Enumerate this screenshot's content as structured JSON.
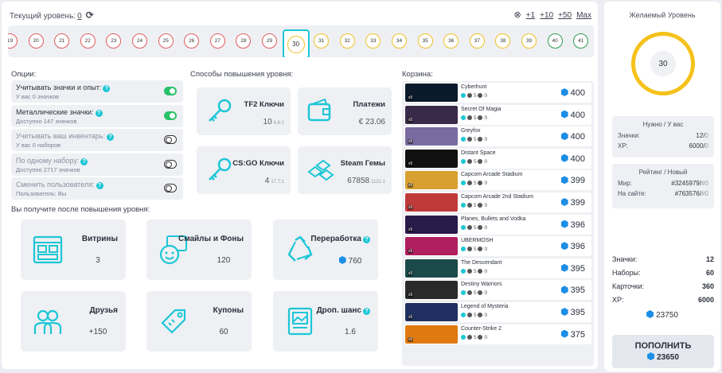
{
  "header": {
    "current_level_label": "Текущий уровень:",
    "current_level_value": "0",
    "plus1": "+1",
    "plus10": "+10",
    "plus50": "+50",
    "max": "Max"
  },
  "levels": [
    {
      "n": "19",
      "c": "r"
    },
    {
      "n": "20",
      "c": "r"
    },
    {
      "n": "21",
      "c": "r"
    },
    {
      "n": "22",
      "c": "r"
    },
    {
      "n": "23",
      "c": "r"
    },
    {
      "n": "24",
      "c": "r"
    },
    {
      "n": "25",
      "c": "r"
    },
    {
      "n": "26",
      "c": "r"
    },
    {
      "n": "27",
      "c": "r"
    },
    {
      "n": "28",
      "c": "r"
    },
    {
      "n": "29",
      "c": "r"
    },
    {
      "n": "30",
      "c": "cur"
    },
    {
      "n": "31",
      "c": "y"
    },
    {
      "n": "32",
      "c": "y"
    },
    {
      "n": "33",
      "c": "y"
    },
    {
      "n": "34",
      "c": "y"
    },
    {
      "n": "35",
      "c": "y"
    },
    {
      "n": "36",
      "c": "y"
    },
    {
      "n": "37",
      "c": "y"
    },
    {
      "n": "38",
      "c": "y"
    },
    {
      "n": "39",
      "c": "y"
    },
    {
      "n": "40",
      "c": "g"
    },
    {
      "n": "41",
      "c": "g"
    }
  ],
  "options": {
    "title": "Опции:",
    "items": [
      {
        "t": "Учитывать значки и опыт:",
        "s": "У вас 0 значков",
        "on": true
      },
      {
        "t": "Металлические значки:",
        "s": "Доступно 147 значков",
        "on": true
      },
      {
        "t": "Учитывать ваш инвентарь:",
        "s": "У вас 0 наборов",
        "on": false
      },
      {
        "t": "По одному набору:",
        "s": "Доступно 2717 значков",
        "on": false
      },
      {
        "t": "Сменить пользователя:",
        "s": "Пользователь: Вы",
        "on": false
      }
    ]
  },
  "ways": {
    "title": "Способы повышения уровня:",
    "items": [
      {
        "n": "TF2 Ключи",
        "v": "10",
        "sub": "6.6:1",
        "icon": "key-icon"
      },
      {
        "n": "Платежи",
        "v": "€ 23.06",
        "sub": "",
        "icon": "wallet-icon"
      },
      {
        "n": "CS:GO Ключи",
        "v": "4",
        "sub": "17.7:1",
        "icon": "key-icon"
      },
      {
        "n": "Steam Гемы",
        "v": "67858",
        "sub": "1131:1",
        "icon": "gems-icon"
      }
    ]
  },
  "gains": {
    "title": "Вы получите после повышения уровня:",
    "items": [
      {
        "n": "Витрины",
        "v": "3",
        "icon": "showcase-icon"
      },
      {
        "n": "Смайлы и Фоны",
        "v": "120",
        "icon": "emoticon-icon"
      },
      {
        "n": "Переработка",
        "v": "760",
        "icon": "recycle-icon"
      },
      {
        "n": "Друзья",
        "v": "+150",
        "icon": "friends-icon"
      },
      {
        "n": "Купоны",
        "v": "60",
        "icon": "coupon-icon"
      },
      {
        "n": "Дроп. шанс",
        "v": "1.6",
        "icon": "album-icon"
      }
    ]
  },
  "cart": {
    "title": "Корзина:",
    "items": [
      {
        "name": "Cyberhunt",
        "price": "400",
        "color": "#0a1a2a"
      },
      {
        "name": "Secret Of Magia",
        "price": "400",
        "color": "#3a2a4a"
      },
      {
        "name": "Greyfox",
        "price": "400",
        "color": "#7a6aa0"
      },
      {
        "name": "Distant Space",
        "price": "400",
        "color": "#111"
      },
      {
        "name": "Capcom Arcade Stadium",
        "price": "399",
        "color": "#d8a030"
      },
      {
        "name": "Capcom Arcade 2nd Stadium",
        "price": "399",
        "color": "#c03a3a"
      },
      {
        "name": "Planes, Bullets and Vodka",
        "price": "396",
        "color": "#2a1a4a"
      },
      {
        "name": "UBERMOSH",
        "price": "396",
        "color": "#b02060"
      },
      {
        "name": "The Descendant",
        "price": "395",
        "color": "#1a4a4a"
      },
      {
        "name": "Destiny Warriors",
        "price": "395",
        "color": "#2a2a2a"
      },
      {
        "name": "Legend of Mysteria",
        "price": "395",
        "color": "#203060"
      },
      {
        "name": "Counter-Strike 2",
        "price": "375",
        "color": "#e07a10"
      }
    ],
    "meta_c": "5",
    "meta_k": "0"
  },
  "side": {
    "title": "Желаемый Уровень",
    "level": "30",
    "need_title": "Нужно / У вас",
    "badges_label": "Значки:",
    "badges_val": "12",
    "badges_have": "0",
    "xp_label": "XP:",
    "xp_val": "6000",
    "xp_have": "0",
    "rank_title": "Рейтинг / Новый",
    "world_label": "Мир:",
    "world_val": "#3245979",
    "world_new": "#0",
    "site_label": "На сайте:",
    "site_val": "#763576",
    "site_new": "#0",
    "sum_badges": "Значки:",
    "sum_badges_v": "12",
    "sum_sets": "Наборы:",
    "sum_sets_v": "60",
    "sum_cards": "Карточки:",
    "sum_cards_v": "360",
    "sum_xp": "XP:",
    "sum_xp_v": "6000",
    "total": "23750",
    "btn_label": "ПОПОЛНИТЬ",
    "btn_price": "23650"
  }
}
